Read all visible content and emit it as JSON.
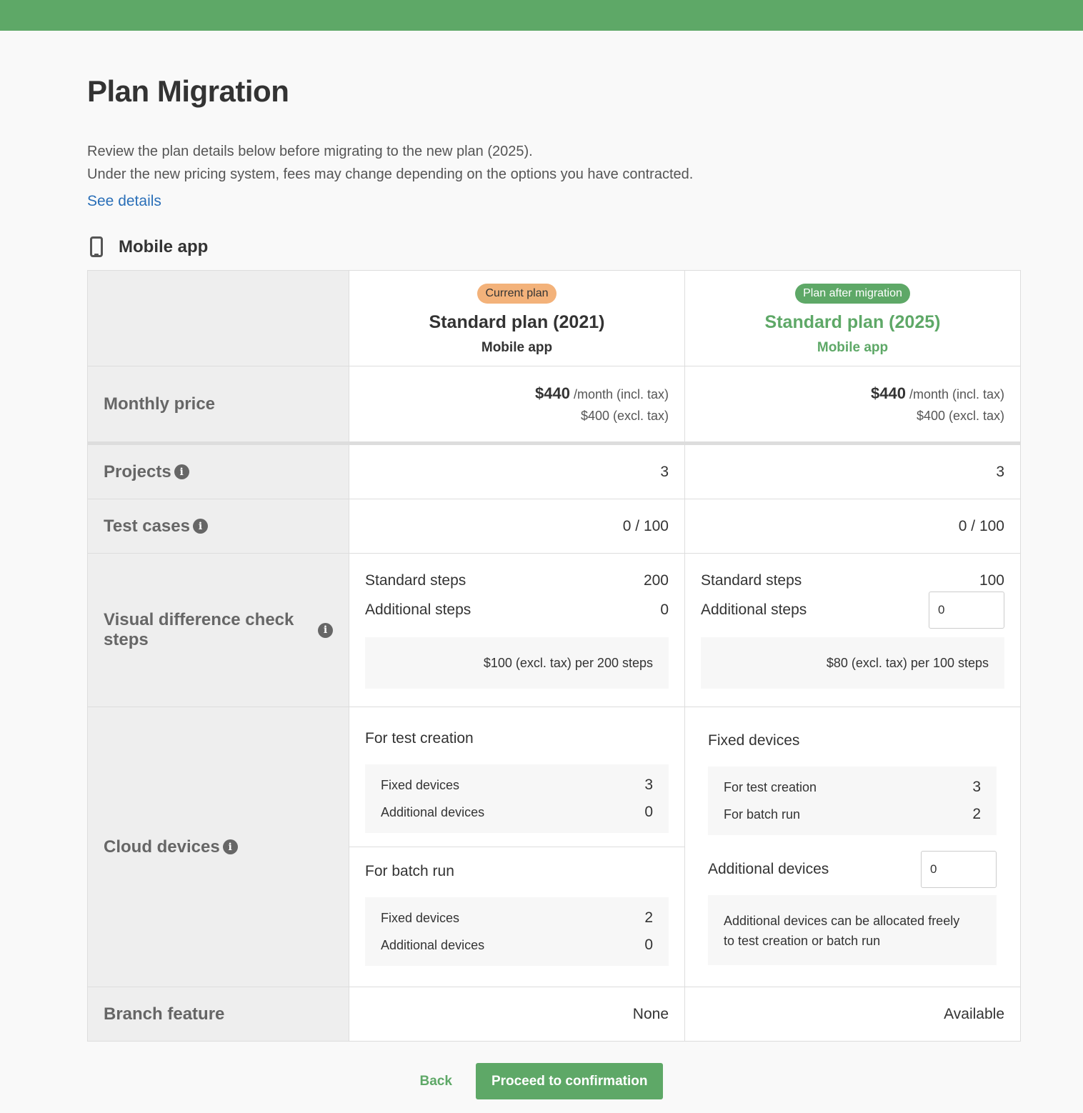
{
  "page": {
    "title": "Plan Migration",
    "description_line1": "Review the plan details below before migrating to the new plan (2025).",
    "description_line2": "Under the new pricing system, fees may change depending on the options you have contracted.",
    "see_details": "See details"
  },
  "section": {
    "title": "Mobile app",
    "icon": "phone-icon"
  },
  "current_plan": {
    "badge": "Current plan",
    "name": "Standard plan (2021)",
    "sub": "Mobile app",
    "price_incl": "$440",
    "price_incl_suffix": "/month (incl. tax)",
    "price_excl": "$400 (excl. tax)",
    "projects": "3",
    "test_cases": "0 / 100",
    "standard_steps_label": "Standard steps",
    "standard_steps": "200",
    "additional_steps_label": "Additional steps",
    "additional_steps": "0",
    "steps_note": "$100 (excl. tax) per 200 steps",
    "test_creation_head": "For test creation",
    "tc_fixed_label": "Fixed devices",
    "tc_fixed": "3",
    "tc_additional_label": "Additional devices",
    "tc_additional": "0",
    "batch_head": "For batch run",
    "br_fixed_label": "Fixed devices",
    "br_fixed": "2",
    "br_additional_label": "Additional devices",
    "br_additional": "0",
    "branch": "None"
  },
  "new_plan": {
    "badge": "Plan after migration",
    "name": "Standard plan (2025)",
    "sub": "Mobile app",
    "price_incl": "$440",
    "price_incl_suffix": "/month (incl. tax)",
    "price_excl": "$400 (excl. tax)",
    "projects": "3",
    "test_cases": "0 / 100",
    "standard_steps_label": "Standard steps",
    "standard_steps": "100",
    "additional_steps_label": "Additional steps",
    "additional_steps_value": "0",
    "steps_note": "$80 (excl. tax) per 100 steps",
    "fixed_head": "Fixed devices",
    "fixed_tc_label": "For test creation",
    "fixed_tc": "3",
    "fixed_br_label": "For batch run",
    "fixed_br": "2",
    "additional_devices_label": "Additional devices",
    "additional_devices_value": "0",
    "additional_note_line1": "Additional devices can be allocated freely",
    "additional_note_line2": "to test creation or batch run",
    "branch": "Available"
  },
  "rows": {
    "monthly_price": "Monthly price",
    "projects": "Projects",
    "test_cases": "Test cases",
    "visual_diff": "Visual difference check steps",
    "cloud_devices": "Cloud devices",
    "branch": "Branch feature"
  },
  "footer": {
    "back": "Back",
    "proceed": "Proceed to confirmation"
  },
  "colors": {
    "accent": "#5ea867",
    "badge_current": "#f3b27a",
    "link": "#2a6fb8"
  }
}
